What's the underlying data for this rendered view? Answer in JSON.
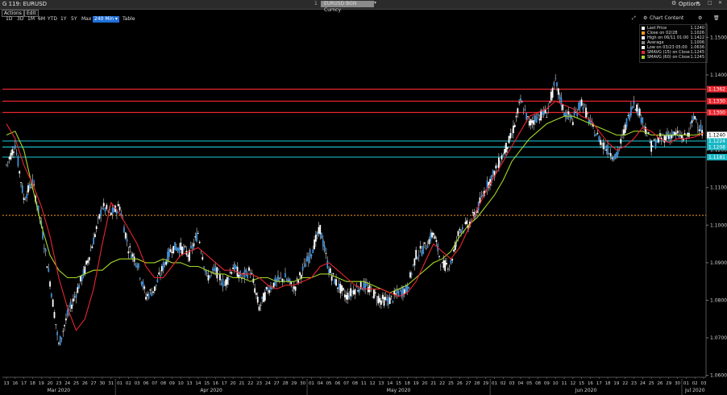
{
  "window": {
    "title": "G 119: EURUSD",
    "ticker_number": "1",
    "ticker": "EURUSD BGN Curncy",
    "options_label": "Options"
  },
  "toolbar": {
    "actions": "Actions",
    "edit": "Edit",
    "ranges": [
      "1D",
      "3D",
      "1M",
      "6M",
      "YTD",
      "1Y",
      "5Y",
      "Max"
    ],
    "interval": "240 Min",
    "table": "Table"
  },
  "chart_panel": {
    "chart_content_label": "Chart Content"
  },
  "legend": [
    {
      "label": "Last Price",
      "value": "1.1240",
      "color": "#ffffff"
    },
    {
      "label": "Close on 02/28",
      "value": "1.1026",
      "color": "#f59b1a"
    },
    {
      "label": "High on 06/11 01:00",
      "value": "1.1422",
      "color": "#ffffff"
    },
    {
      "label": "Average",
      "value": "1.1006",
      "color": "#888888"
    },
    {
      "label": "Low on 03/23 05:00",
      "value": "1.0636",
      "color": "#ffffff"
    },
    {
      "label": "SMAVG (15)  on Close",
      "value": "1.1245",
      "color": "#e8262f"
    },
    {
      "label": "SMAVG (60)  on Close",
      "value": "1.1245",
      "color": "#a6d82a"
    }
  ],
  "chart_data": {
    "type": "line",
    "chart_style": "candlestick",
    "y_ticks": [
      "1.1500",
      "1.1400",
      "1.1300",
      "1.1200",
      "1.1100",
      "1.1000",
      "1.0900",
      "1.0800",
      "1.0700",
      "1.0600"
    ],
    "ylim": [
      1.0595,
      1.1535
    ],
    "x_day_ticks": [
      "13",
      "16",
      "17",
      "18",
      "19",
      "20",
      "23",
      "24",
      "25",
      "26",
      "27",
      "30",
      "31",
      "01",
      "02",
      "03",
      "06",
      "07",
      "08",
      "09",
      "10",
      "13",
      "14",
      "15",
      "16",
      "17",
      "20",
      "21",
      "22",
      "23",
      "24",
      "27",
      "28",
      "29",
      "30",
      "01",
      "04",
      "05",
      "06",
      "07",
      "08",
      "11",
      "12",
      "13",
      "14",
      "15",
      "18",
      "19",
      "20",
      "21",
      "22",
      "25",
      "26",
      "27",
      "28",
      "29",
      "01",
      "02",
      "03",
      "04",
      "05",
      "08",
      "09",
      "10",
      "11",
      "12",
      "15",
      "16",
      "17",
      "18",
      "19",
      "22",
      "23",
      "24",
      "25",
      "26",
      "29",
      "30",
      "01",
      "02",
      "03"
    ],
    "x_months": [
      {
        "label": "Mar 2020",
        "start": 0,
        "end": 12
      },
      {
        "label": "Apr 2020",
        "start": 13,
        "end": 34
      },
      {
        "label": "May 2020",
        "start": 35,
        "end": 55
      },
      {
        "label": "Jun 2020",
        "start": 56,
        "end": 77
      },
      {
        "label": "Jul 2020",
        "start": 78,
        "end": 80
      }
    ],
    "horizontal_lines": [
      {
        "value": 1.1362,
        "label": "1.1362",
        "color": "#e8262f"
      },
      {
        "value": 1.133,
        "label": "1.1330",
        "color": "#e8262f"
      },
      {
        "value": 1.13,
        "label": "1.1300",
        "color": "#e8262f"
      },
      {
        "value": 1.1224,
        "label": "1.1224",
        "color": "#19b6c4"
      },
      {
        "value": 1.1208,
        "label": "1.1208",
        "color": "#19b6c4"
      },
      {
        "value": 1.1181,
        "label": "1.1181",
        "color": "#19b6c4"
      },
      {
        "value": 1.1026,
        "label": "",
        "color": "#f59b1a",
        "dashed": true
      }
    ],
    "last_price_label": "1.1240",
    "close_series": [
      1.116,
      1.1215,
      1.107,
      1.1115,
      1.1,
      1.085,
      1.068,
      1.076,
      1.082,
      1.088,
      1.096,
      1.105,
      1.103,
      1.105,
      1.094,
      1.09,
      1.081,
      1.083,
      1.089,
      1.094,
      1.094,
      1.092,
      1.098,
      1.086,
      1.088,
      1.084,
      1.089,
      1.086,
      1.088,
      1.078,
      1.083,
      1.085,
      1.086,
      1.083,
      1.088,
      1.093,
      1.099,
      1.088,
      1.084,
      1.081,
      1.083,
      1.084,
      1.082,
      1.08,
      1.08,
      1.082,
      1.083,
      1.092,
      1.094,
      1.098,
      1.089,
      1.09,
      1.099,
      1.1,
      1.104,
      1.11,
      1.114,
      1.119,
      1.124,
      1.133,
      1.127,
      1.129,
      1.13,
      1.138,
      1.13,
      1.128,
      1.133,
      1.127,
      1.123,
      1.12,
      1.118,
      1.126,
      1.133,
      1.128,
      1.121,
      1.123,
      1.124,
      1.124,
      1.123,
      1.129,
      1.124
    ],
    "sma15_series": [
      1.127,
      1.123,
      1.116,
      1.111,
      1.105,
      1.097,
      1.086,
      1.078,
      1.072,
      1.075,
      1.083,
      1.095,
      1.106,
      1.103,
      1.099,
      1.095,
      1.089,
      1.086,
      1.086,
      1.089,
      1.092,
      1.093,
      1.094,
      1.092,
      1.09,
      1.088,
      1.088,
      1.087,
      1.087,
      1.086,
      1.084,
      1.083,
      1.084,
      1.084,
      1.085,
      1.086,
      1.089,
      1.09,
      1.088,
      1.086,
      1.084,
      1.083,
      1.083,
      1.083,
      1.082,
      1.081,
      1.082,
      1.085,
      1.09,
      1.095,
      1.093,
      1.091,
      1.094,
      1.099,
      1.104,
      1.109,
      1.113,
      1.117,
      1.121,
      1.125,
      1.129,
      1.13,
      1.131,
      1.133,
      1.132,
      1.131,
      1.129,
      1.128,
      1.125,
      1.122,
      1.12,
      1.121,
      1.123,
      1.126,
      1.125,
      1.123,
      1.122,
      1.123,
      1.123,
      1.1235,
      1.1245
    ],
    "sma60_series": [
      1.124,
      1.125,
      1.12,
      1.11,
      1.1,
      1.092,
      1.088,
      1.086,
      1.086,
      1.087,
      1.088,
      1.088,
      1.09,
      1.091,
      1.091,
      1.091,
      1.09,
      1.09,
      1.091,
      1.09,
      1.09,
      1.089,
      1.089,
      1.088,
      1.087,
      1.087,
      1.086,
      1.086,
      1.085,
      1.086,
      1.086,
      1.085,
      1.085,
      1.085,
      1.086,
      1.086,
      1.087,
      1.087,
      1.086,
      1.085,
      1.085,
      1.085,
      1.084,
      1.083,
      1.082,
      1.083,
      1.084,
      1.086,
      1.088,
      1.09,
      1.091,
      1.093,
      1.097,
      1.1,
      1.102,
      1.105,
      1.108,
      1.112,
      1.117,
      1.12,
      1.123,
      1.125,
      1.127,
      1.128,
      1.129,
      1.129,
      1.128,
      1.127,
      1.126,
      1.125,
      1.124,
      1.124,
      1.125,
      1.125,
      1.124,
      1.124,
      1.124,
      1.124,
      1.124,
      1.124,
      1.1245
    ],
    "grid": false,
    "legend_position": "top-right"
  }
}
